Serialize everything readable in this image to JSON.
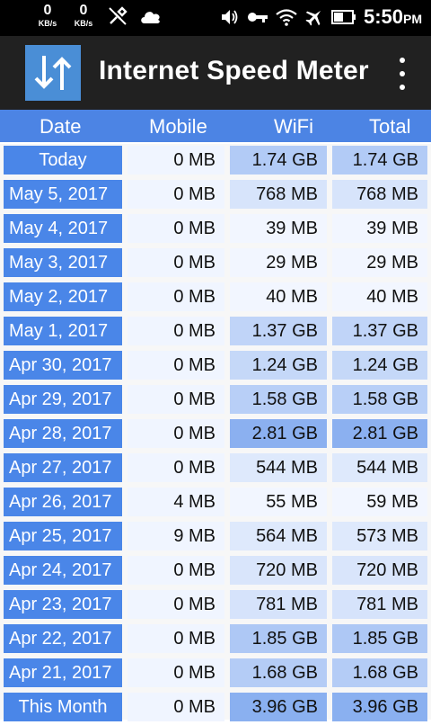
{
  "status_bar": {
    "net_up": {
      "value": "0",
      "unit": "KB/s"
    },
    "net_down": {
      "value": "0",
      "unit": "KB/s"
    },
    "icons": [
      "no-usb-icon",
      "cloud-icon",
      "volume-icon",
      "key-icon",
      "wifi-icon",
      "airplane-icon",
      "battery-icon"
    ],
    "time": "5:50",
    "ampm": "PM"
  },
  "app": {
    "title": "Internet Speed Meter",
    "logo_color": "#4a8ed6",
    "menu_icon": "overflow-menu-icon"
  },
  "table": {
    "headers": {
      "date": "Date",
      "mobile": "Mobile",
      "wifi": "WiFi",
      "total": "Total"
    },
    "rows": [
      {
        "date": "Today",
        "mobile": "0 MB",
        "wifi": "1.74 GB",
        "total": "1.74 GB",
        "level": 0.44
      },
      {
        "date": "May 5, 2017",
        "mobile": "0 MB",
        "wifi": "768 MB",
        "total": "768 MB",
        "level": 0.19
      },
      {
        "date": "May 4, 2017",
        "mobile": "0 MB",
        "wifi": "39 MB",
        "total": "39 MB",
        "level": 0.01
      },
      {
        "date": "May 3, 2017",
        "mobile": "0 MB",
        "wifi": "29 MB",
        "total": "29 MB",
        "level": 0.01
      },
      {
        "date": "May 2, 2017",
        "mobile": "0 MB",
        "wifi": "40 MB",
        "total": "40 MB",
        "level": 0.01
      },
      {
        "date": "May 1, 2017",
        "mobile": "0 MB",
        "wifi": "1.37 GB",
        "total": "1.37 GB",
        "level": 0.35
      },
      {
        "date": "Apr 30, 2017",
        "mobile": "0 MB",
        "wifi": "1.24 GB",
        "total": "1.24 GB",
        "level": 0.31
      },
      {
        "date": "Apr 29, 2017",
        "mobile": "0 MB",
        "wifi": "1.58 GB",
        "total": "1.58 GB",
        "level": 0.4
      },
      {
        "date": "Apr 28, 2017",
        "mobile": "0 MB",
        "wifi": "2.81 GB",
        "total": "2.81 GB",
        "level": 0.71
      },
      {
        "date": "Apr 27, 2017",
        "mobile": "0 MB",
        "wifi": "544 MB",
        "total": "544 MB",
        "level": 0.14
      },
      {
        "date": "Apr 26, 2017",
        "mobile": "4 MB",
        "wifi": "55 MB",
        "total": "59 MB",
        "level": 0.01
      },
      {
        "date": "Apr 25, 2017",
        "mobile": "9 MB",
        "wifi": "564 MB",
        "total": "573 MB",
        "level": 0.14
      },
      {
        "date": "Apr 24, 2017",
        "mobile": "0 MB",
        "wifi": "720 MB",
        "total": "720 MB",
        "level": 0.18
      },
      {
        "date": "Apr 23, 2017",
        "mobile": "0 MB",
        "wifi": "781 MB",
        "total": "781 MB",
        "level": 0.2
      },
      {
        "date": "Apr 22, 2017",
        "mobile": "0 MB",
        "wifi": "1.85 GB",
        "total": "1.85 GB",
        "level": 0.47
      },
      {
        "date": "Apr 21, 2017",
        "mobile": "0 MB",
        "wifi": "1.68 GB",
        "total": "1.68 GB",
        "level": 0.43
      },
      {
        "date": "This Month",
        "mobile": "0 MB",
        "wifi": "3.96 GB",
        "total": "3.96 GB",
        "level": 1.0
      }
    ]
  },
  "colors": {
    "header_bg": "#4c84e4",
    "date_cell": "#4a86e8",
    "usage_high": "#8ab0f0",
    "usage_low": "#f3f7ff"
  }
}
